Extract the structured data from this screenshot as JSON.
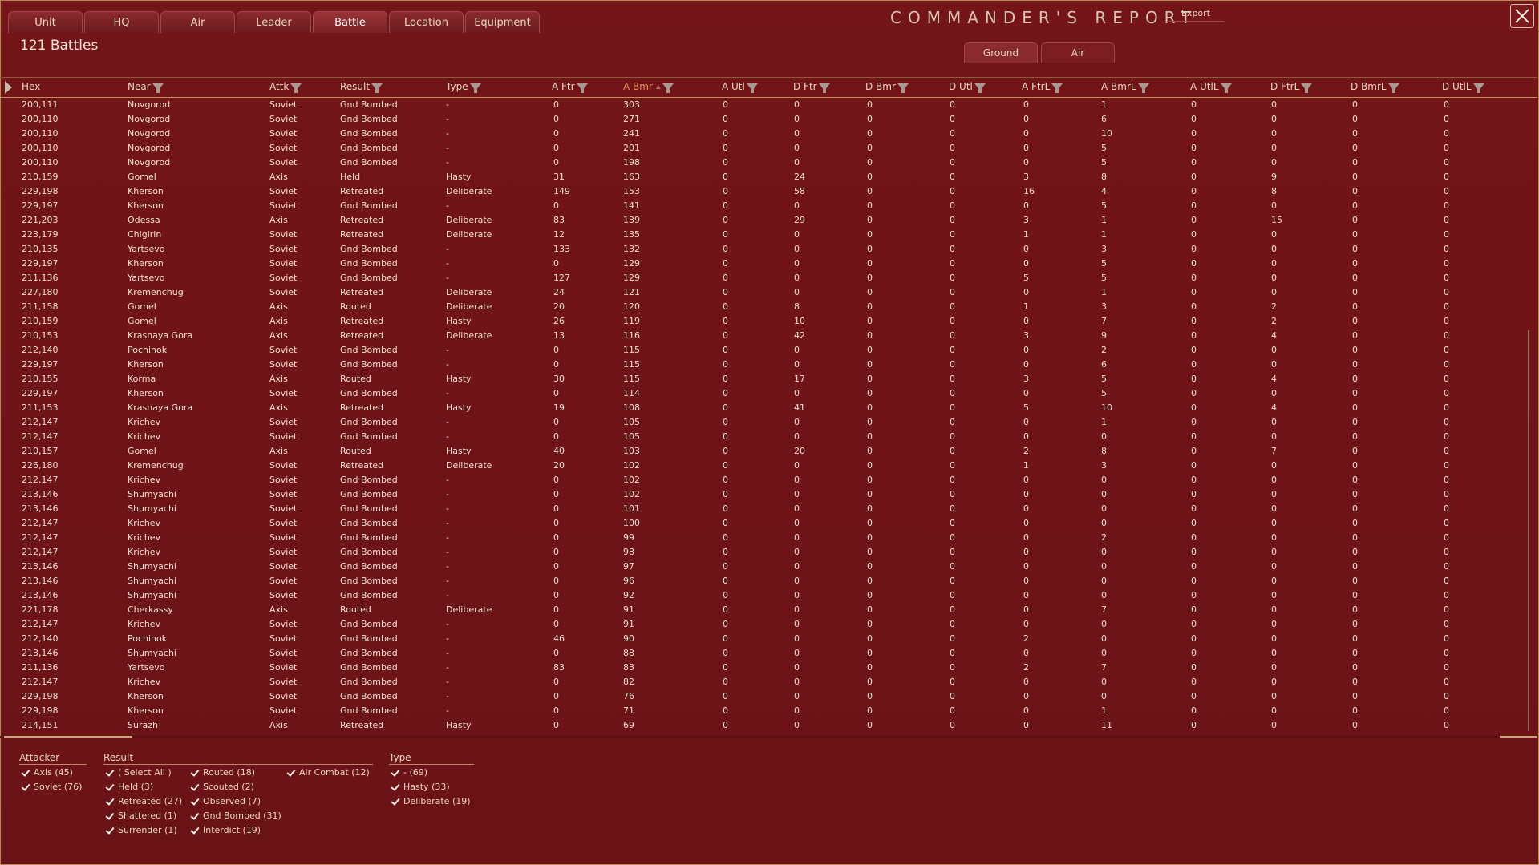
{
  "tabs": [
    "Unit",
    "HQ",
    "Air",
    "Leader",
    "Battle",
    "Location",
    "Equipment"
  ],
  "active_tab": "Battle",
  "report_title": "COMMANDER'S REPORT",
  "export_label": "Export",
  "battle_count": "121 Battles",
  "subtabs": [
    "Ground",
    "Air"
  ],
  "active_subtab": "Air",
  "columns": [
    "Hex",
    "Near",
    "Attk",
    "Result",
    "Type",
    "A Ftr",
    "A Bmr",
    "A Utl",
    "D Ftr",
    "D Bmr",
    "D Utl",
    "A FtrL",
    "A BmrL",
    "A UtlL",
    "D FtrL",
    "D BmrL",
    "D UtlL"
  ],
  "sorted_column": "A Bmr",
  "rows": [
    [
      "200,111",
      "Novgorod",
      "Soviet",
      "Gnd Bombed",
      "-",
      "0",
      "303",
      "0",
      "0",
      "0",
      "0",
      "0",
      "1",
      "0",
      "0",
      "0",
      "0"
    ],
    [
      "200,110",
      "Novgorod",
      "Soviet",
      "Gnd Bombed",
      "-",
      "0",
      "271",
      "0",
      "0",
      "0",
      "0",
      "0",
      "6",
      "0",
      "0",
      "0",
      "0"
    ],
    [
      "200,110",
      "Novgorod",
      "Soviet",
      "Gnd Bombed",
      "-",
      "0",
      "241",
      "0",
      "0",
      "0",
      "0",
      "0",
      "10",
      "0",
      "0",
      "0",
      "0"
    ],
    [
      "200,110",
      "Novgorod",
      "Soviet",
      "Gnd Bombed",
      "-",
      "0",
      "201",
      "0",
      "0",
      "0",
      "0",
      "0",
      "5",
      "0",
      "0",
      "0",
      "0"
    ],
    [
      "200,110",
      "Novgorod",
      "Soviet",
      "Gnd Bombed",
      "-",
      "0",
      "198",
      "0",
      "0",
      "0",
      "0",
      "0",
      "5",
      "0",
      "0",
      "0",
      "0"
    ],
    [
      "210,159",
      "Gomel",
      "Axis",
      "Held",
      "Hasty",
      "31",
      "163",
      "0",
      "24",
      "0",
      "0",
      "3",
      "8",
      "0",
      "9",
      "0",
      "0"
    ],
    [
      "229,198",
      "Kherson",
      "Soviet",
      "Retreated",
      "Deliberate",
      "149",
      "153",
      "0",
      "58",
      "0",
      "0",
      "16",
      "4",
      "0",
      "8",
      "0",
      "0"
    ],
    [
      "229,197",
      "Kherson",
      "Soviet",
      "Gnd Bombed",
      "-",
      "0",
      "141",
      "0",
      "0",
      "0",
      "0",
      "0",
      "5",
      "0",
      "0",
      "0",
      "0"
    ],
    [
      "221,203",
      "Odessa",
      "Axis",
      "Retreated",
      "Deliberate",
      "83",
      "139",
      "0",
      "29",
      "0",
      "0",
      "3",
      "1",
      "0",
      "15",
      "0",
      "0"
    ],
    [
      "223,179",
      "Chigirin",
      "Soviet",
      "Retreated",
      "Deliberate",
      "12",
      "135",
      "0",
      "0",
      "0",
      "0",
      "1",
      "1",
      "0",
      "0",
      "0",
      "0"
    ],
    [
      "210,135",
      "Yartsevo",
      "Soviet",
      "Gnd Bombed",
      "-",
      "133",
      "132",
      "0",
      "0",
      "0",
      "0",
      "0",
      "3",
      "0",
      "0",
      "0",
      "0"
    ],
    [
      "229,197",
      "Kherson",
      "Soviet",
      "Gnd Bombed",
      "-",
      "0",
      "129",
      "0",
      "0",
      "0",
      "0",
      "0",
      "5",
      "0",
      "0",
      "0",
      "0"
    ],
    [
      "211,136",
      "Yartsevo",
      "Soviet",
      "Gnd Bombed",
      "-",
      "127",
      "129",
      "0",
      "0",
      "0",
      "0",
      "5",
      "5",
      "0",
      "0",
      "0",
      "0"
    ],
    [
      "227,180",
      "Kremenchug",
      "Soviet",
      "Retreated",
      "Deliberate",
      "24",
      "121",
      "0",
      "0",
      "0",
      "0",
      "0",
      "1",
      "0",
      "0",
      "0",
      "0"
    ],
    [
      "211,158",
      "Gomel",
      "Axis",
      "Routed",
      "Deliberate",
      "20",
      "120",
      "0",
      "8",
      "0",
      "0",
      "1",
      "3",
      "0",
      "2",
      "0",
      "0"
    ],
    [
      "210,159",
      "Gomel",
      "Axis",
      "Retreated",
      "Hasty",
      "26",
      "119",
      "0",
      "10",
      "0",
      "0",
      "0",
      "7",
      "0",
      "2",
      "0",
      "0"
    ],
    [
      "210,153",
      "Krasnaya Gora",
      "Axis",
      "Retreated",
      "Deliberate",
      "13",
      "116",
      "0",
      "42",
      "0",
      "0",
      "3",
      "9",
      "0",
      "4",
      "0",
      "0"
    ],
    [
      "212,140",
      "Pochinok",
      "Soviet",
      "Gnd Bombed",
      "-",
      "0",
      "115",
      "0",
      "0",
      "0",
      "0",
      "0",
      "2",
      "0",
      "0",
      "0",
      "0"
    ],
    [
      "229,197",
      "Kherson",
      "Soviet",
      "Gnd Bombed",
      "-",
      "0",
      "115",
      "0",
      "0",
      "0",
      "0",
      "0",
      "6",
      "0",
      "0",
      "0",
      "0"
    ],
    [
      "210,155",
      "Korma",
      "Axis",
      "Routed",
      "Hasty",
      "30",
      "115",
      "0",
      "17",
      "0",
      "0",
      "3",
      "5",
      "0",
      "4",
      "0",
      "0"
    ],
    [
      "229,197",
      "Kherson",
      "Soviet",
      "Gnd Bombed",
      "-",
      "0",
      "114",
      "0",
      "0",
      "0",
      "0",
      "0",
      "5",
      "0",
      "0",
      "0",
      "0"
    ],
    [
      "211,153",
      "Krasnaya Gora",
      "Axis",
      "Retreated",
      "Hasty",
      "19",
      "108",
      "0",
      "41",
      "0",
      "0",
      "5",
      "10",
      "0",
      "4",
      "0",
      "0"
    ],
    [
      "212,147",
      "Krichev",
      "Soviet",
      "Gnd Bombed",
      "-",
      "0",
      "105",
      "0",
      "0",
      "0",
      "0",
      "0",
      "1",
      "0",
      "0",
      "0",
      "0"
    ],
    [
      "212,147",
      "Krichev",
      "Soviet",
      "Gnd Bombed",
      "-",
      "0",
      "105",
      "0",
      "0",
      "0",
      "0",
      "0",
      "0",
      "0",
      "0",
      "0",
      "0"
    ],
    [
      "210,157",
      "Gomel",
      "Axis",
      "Routed",
      "Hasty",
      "40",
      "103",
      "0",
      "20",
      "0",
      "0",
      "2",
      "8",
      "0",
      "7",
      "0",
      "0"
    ],
    [
      "226,180",
      "Kremenchug",
      "Soviet",
      "Retreated",
      "Deliberate",
      "20",
      "102",
      "0",
      "0",
      "0",
      "0",
      "1",
      "3",
      "0",
      "0",
      "0",
      "0"
    ],
    [
      "212,147",
      "Krichev",
      "Soviet",
      "Gnd Bombed",
      "-",
      "0",
      "102",
      "0",
      "0",
      "0",
      "0",
      "0",
      "0",
      "0",
      "0",
      "0",
      "0"
    ],
    [
      "213,146",
      "Shumyachi",
      "Soviet",
      "Gnd Bombed",
      "-",
      "0",
      "102",
      "0",
      "0",
      "0",
      "0",
      "0",
      "0",
      "0",
      "0",
      "0",
      "0"
    ],
    [
      "213,146",
      "Shumyachi",
      "Soviet",
      "Gnd Bombed",
      "-",
      "0",
      "101",
      "0",
      "0",
      "0",
      "0",
      "0",
      "0",
      "0",
      "0",
      "0",
      "0"
    ],
    [
      "212,147",
      "Krichev",
      "Soviet",
      "Gnd Bombed",
      "-",
      "0",
      "100",
      "0",
      "0",
      "0",
      "0",
      "0",
      "0",
      "0",
      "0",
      "0",
      "0"
    ],
    [
      "212,147",
      "Krichev",
      "Soviet",
      "Gnd Bombed",
      "-",
      "0",
      "99",
      "0",
      "0",
      "0",
      "0",
      "0",
      "2",
      "0",
      "0",
      "0",
      "0"
    ],
    [
      "212,147",
      "Krichev",
      "Soviet",
      "Gnd Bombed",
      "-",
      "0",
      "98",
      "0",
      "0",
      "0",
      "0",
      "0",
      "0",
      "0",
      "0",
      "0",
      "0"
    ],
    [
      "213,146",
      "Shumyachi",
      "Soviet",
      "Gnd Bombed",
      "-",
      "0",
      "97",
      "0",
      "0",
      "0",
      "0",
      "0",
      "0",
      "0",
      "0",
      "0",
      "0"
    ],
    [
      "213,146",
      "Shumyachi",
      "Soviet",
      "Gnd Bombed",
      "-",
      "0",
      "96",
      "0",
      "0",
      "0",
      "0",
      "0",
      "0",
      "0",
      "0",
      "0",
      "0"
    ],
    [
      "213,146",
      "Shumyachi",
      "Soviet",
      "Gnd Bombed",
      "-",
      "0",
      "92",
      "0",
      "0",
      "0",
      "0",
      "0",
      "0",
      "0",
      "0",
      "0",
      "0"
    ],
    [
      "221,178",
      "Cherkassy",
      "Axis",
      "Routed",
      "Deliberate",
      "0",
      "91",
      "0",
      "0",
      "0",
      "0",
      "0",
      "7",
      "0",
      "0",
      "0",
      "0"
    ],
    [
      "212,147",
      "Krichev",
      "Soviet",
      "Gnd Bombed",
      "-",
      "0",
      "91",
      "0",
      "0",
      "0",
      "0",
      "0",
      "0",
      "0",
      "0",
      "0",
      "0"
    ],
    [
      "212,140",
      "Pochinok",
      "Soviet",
      "Gnd Bombed",
      "-",
      "46",
      "90",
      "0",
      "0",
      "0",
      "0",
      "2",
      "0",
      "0",
      "0",
      "0",
      "0"
    ],
    [
      "213,146",
      "Shumyachi",
      "Soviet",
      "Gnd Bombed",
      "-",
      "0",
      "88",
      "0",
      "0",
      "0",
      "0",
      "0",
      "0",
      "0",
      "0",
      "0",
      "0"
    ],
    [
      "211,136",
      "Yartsevo",
      "Soviet",
      "Gnd Bombed",
      "-",
      "83",
      "83",
      "0",
      "0",
      "0",
      "0",
      "2",
      "7",
      "0",
      "0",
      "0",
      "0"
    ],
    [
      "212,147",
      "Krichev",
      "Soviet",
      "Gnd Bombed",
      "-",
      "0",
      "82",
      "0",
      "0",
      "0",
      "0",
      "0",
      "0",
      "0",
      "0",
      "0",
      "0"
    ],
    [
      "229,198",
      "Kherson",
      "Soviet",
      "Gnd Bombed",
      "-",
      "0",
      "76",
      "0",
      "0",
      "0",
      "0",
      "0",
      "0",
      "0",
      "0",
      "0",
      "0"
    ],
    [
      "229,198",
      "Kherson",
      "Soviet",
      "Gnd Bombed",
      "-",
      "0",
      "71",
      "0",
      "0",
      "0",
      "0",
      "0",
      "1",
      "0",
      "0",
      "0",
      "0"
    ],
    [
      "214,151",
      "Surazh",
      "Axis",
      "Retreated",
      "Hasty",
      "0",
      "69",
      "0",
      "0",
      "0",
      "0",
      "0",
      "11",
      "0",
      "0",
      "0",
      "0"
    ]
  ],
  "filters": {
    "attacker": {
      "title": "Attacker",
      "items": [
        "Axis (45)",
        "Soviet (76)"
      ]
    },
    "result": {
      "title": "Result",
      "items": [
        "( Select All )",
        "Held  (3)",
        "Retreated  (27)",
        "Shattered  (1)",
        "Surrender  (1)",
        "Routed  (18)",
        "Scouted (2)",
        "Observed (7)",
        "Gnd Bombed (31)",
        "Interdict (19)",
        "Air Combat (12)"
      ]
    },
    "type": {
      "title": "Type",
      "items": [
        "-  (69)",
        "Hasty (33)",
        "Deliberate (19)"
      ]
    }
  },
  "colors": {
    "background": "#6e1418",
    "accent_sorted": "#e89060",
    "border": "#b58a4a"
  }
}
